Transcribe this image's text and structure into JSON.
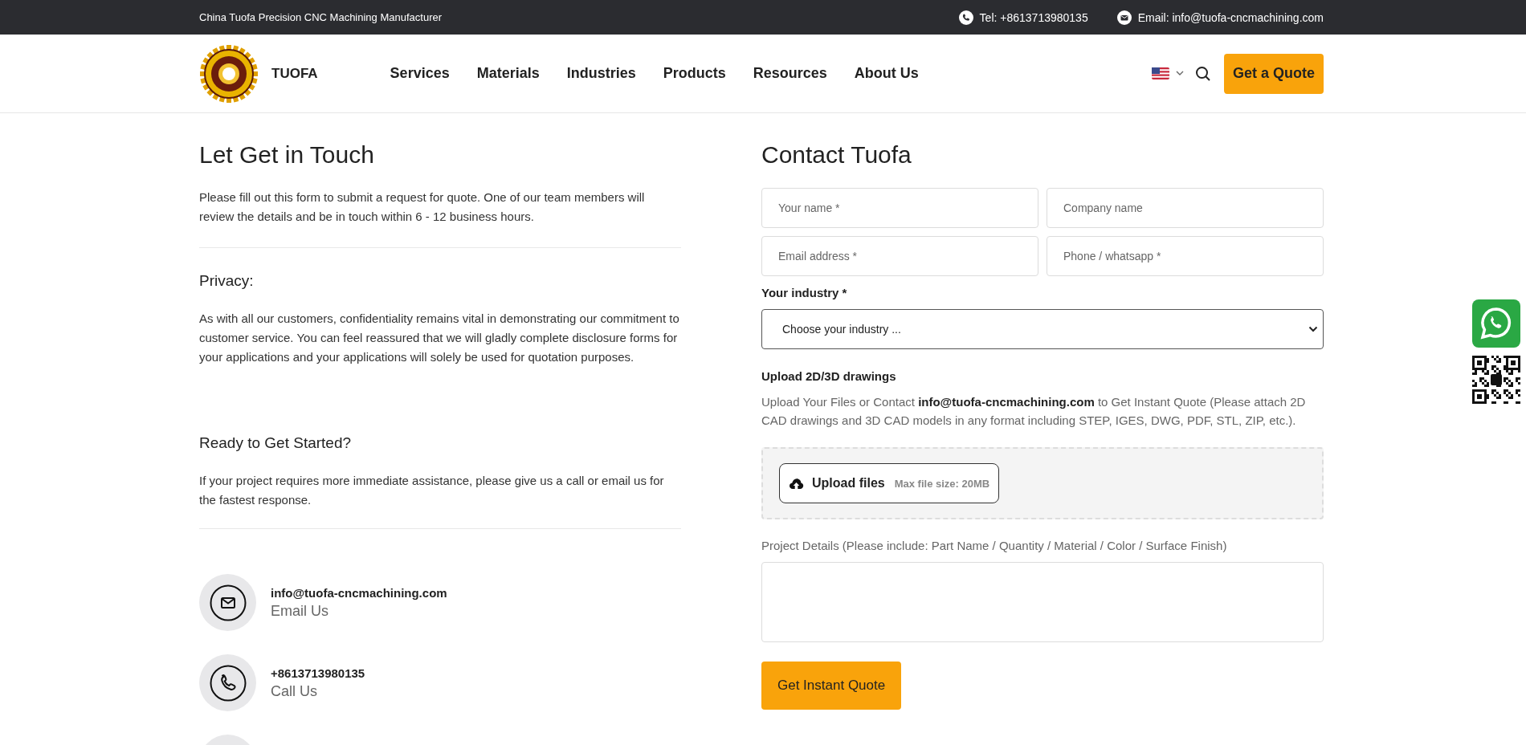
{
  "top_bar": {
    "tagline": "China Tuofa Precision CNC Machining Manufacturer",
    "phone": "Tel: +8613713980135",
    "email": "Email: info@tuofa-cncmachining.com"
  },
  "header": {
    "brand": "TUOFA",
    "nav": [
      "Services",
      "Materials",
      "Industries",
      "Products",
      "Resources",
      "About Us"
    ],
    "quote_button": "Get a Quote"
  },
  "intro": {
    "title": "Let Get in Touch",
    "text": "Please fill out this form to submit a request for quote. One of our team members will review the details and be in touch within 6 - 12 business hours.",
    "sections": [
      {
        "heading": "Privacy:",
        "text": "As with all our customers, confidentiality remains vital in demonstrating our commitment to customer service. You can feel reassured that we will gladly complete disclosure forms for your applications and your applications will solely be used for quotation purposes."
      },
      {
        "heading": "Ready to Get Started?",
        "text": "If your project requires more immediate assistance, please give us a call or email us for the fastest response."
      }
    ],
    "contacts": [
      {
        "kind": "email",
        "value": "info@tuofa-cncmachining.com",
        "label": "Email Us"
      },
      {
        "kind": "phone",
        "value": "+8613713980135",
        "label": "Call Us"
      },
      {
        "kind": "cut"
      }
    ]
  },
  "form": {
    "title": "Contact Tuofa",
    "fields": [
      {
        "placeholder": "Your name *"
      },
      {
        "placeholder": "Company name"
      },
      {
        "placeholder": "Email address *"
      },
      {
        "placeholder": "Phone / whatsapp *"
      }
    ],
    "industry_label": "Your industry *",
    "industry_select": "Choose your industry ...",
    "upload_heading": "Upload 2D/3D drawings",
    "upload_text": "Upload Your Files or Contact **info@tuofa-cncmachining.com** to Get Instant Quote (Please attach 2D CAD drawings and 3D CAD models in any format including STEP, IGES, DWG, PDF, STL, ZIP, etc.).",
    "upload_button": "Upload files",
    "max_size": "Max file size: 20MB",
    "details_label": "Project Details (Please include: Part Name / Quantity / Material / Color / Surface Finish)",
    "submit": "Get Instant Quote"
  }
}
